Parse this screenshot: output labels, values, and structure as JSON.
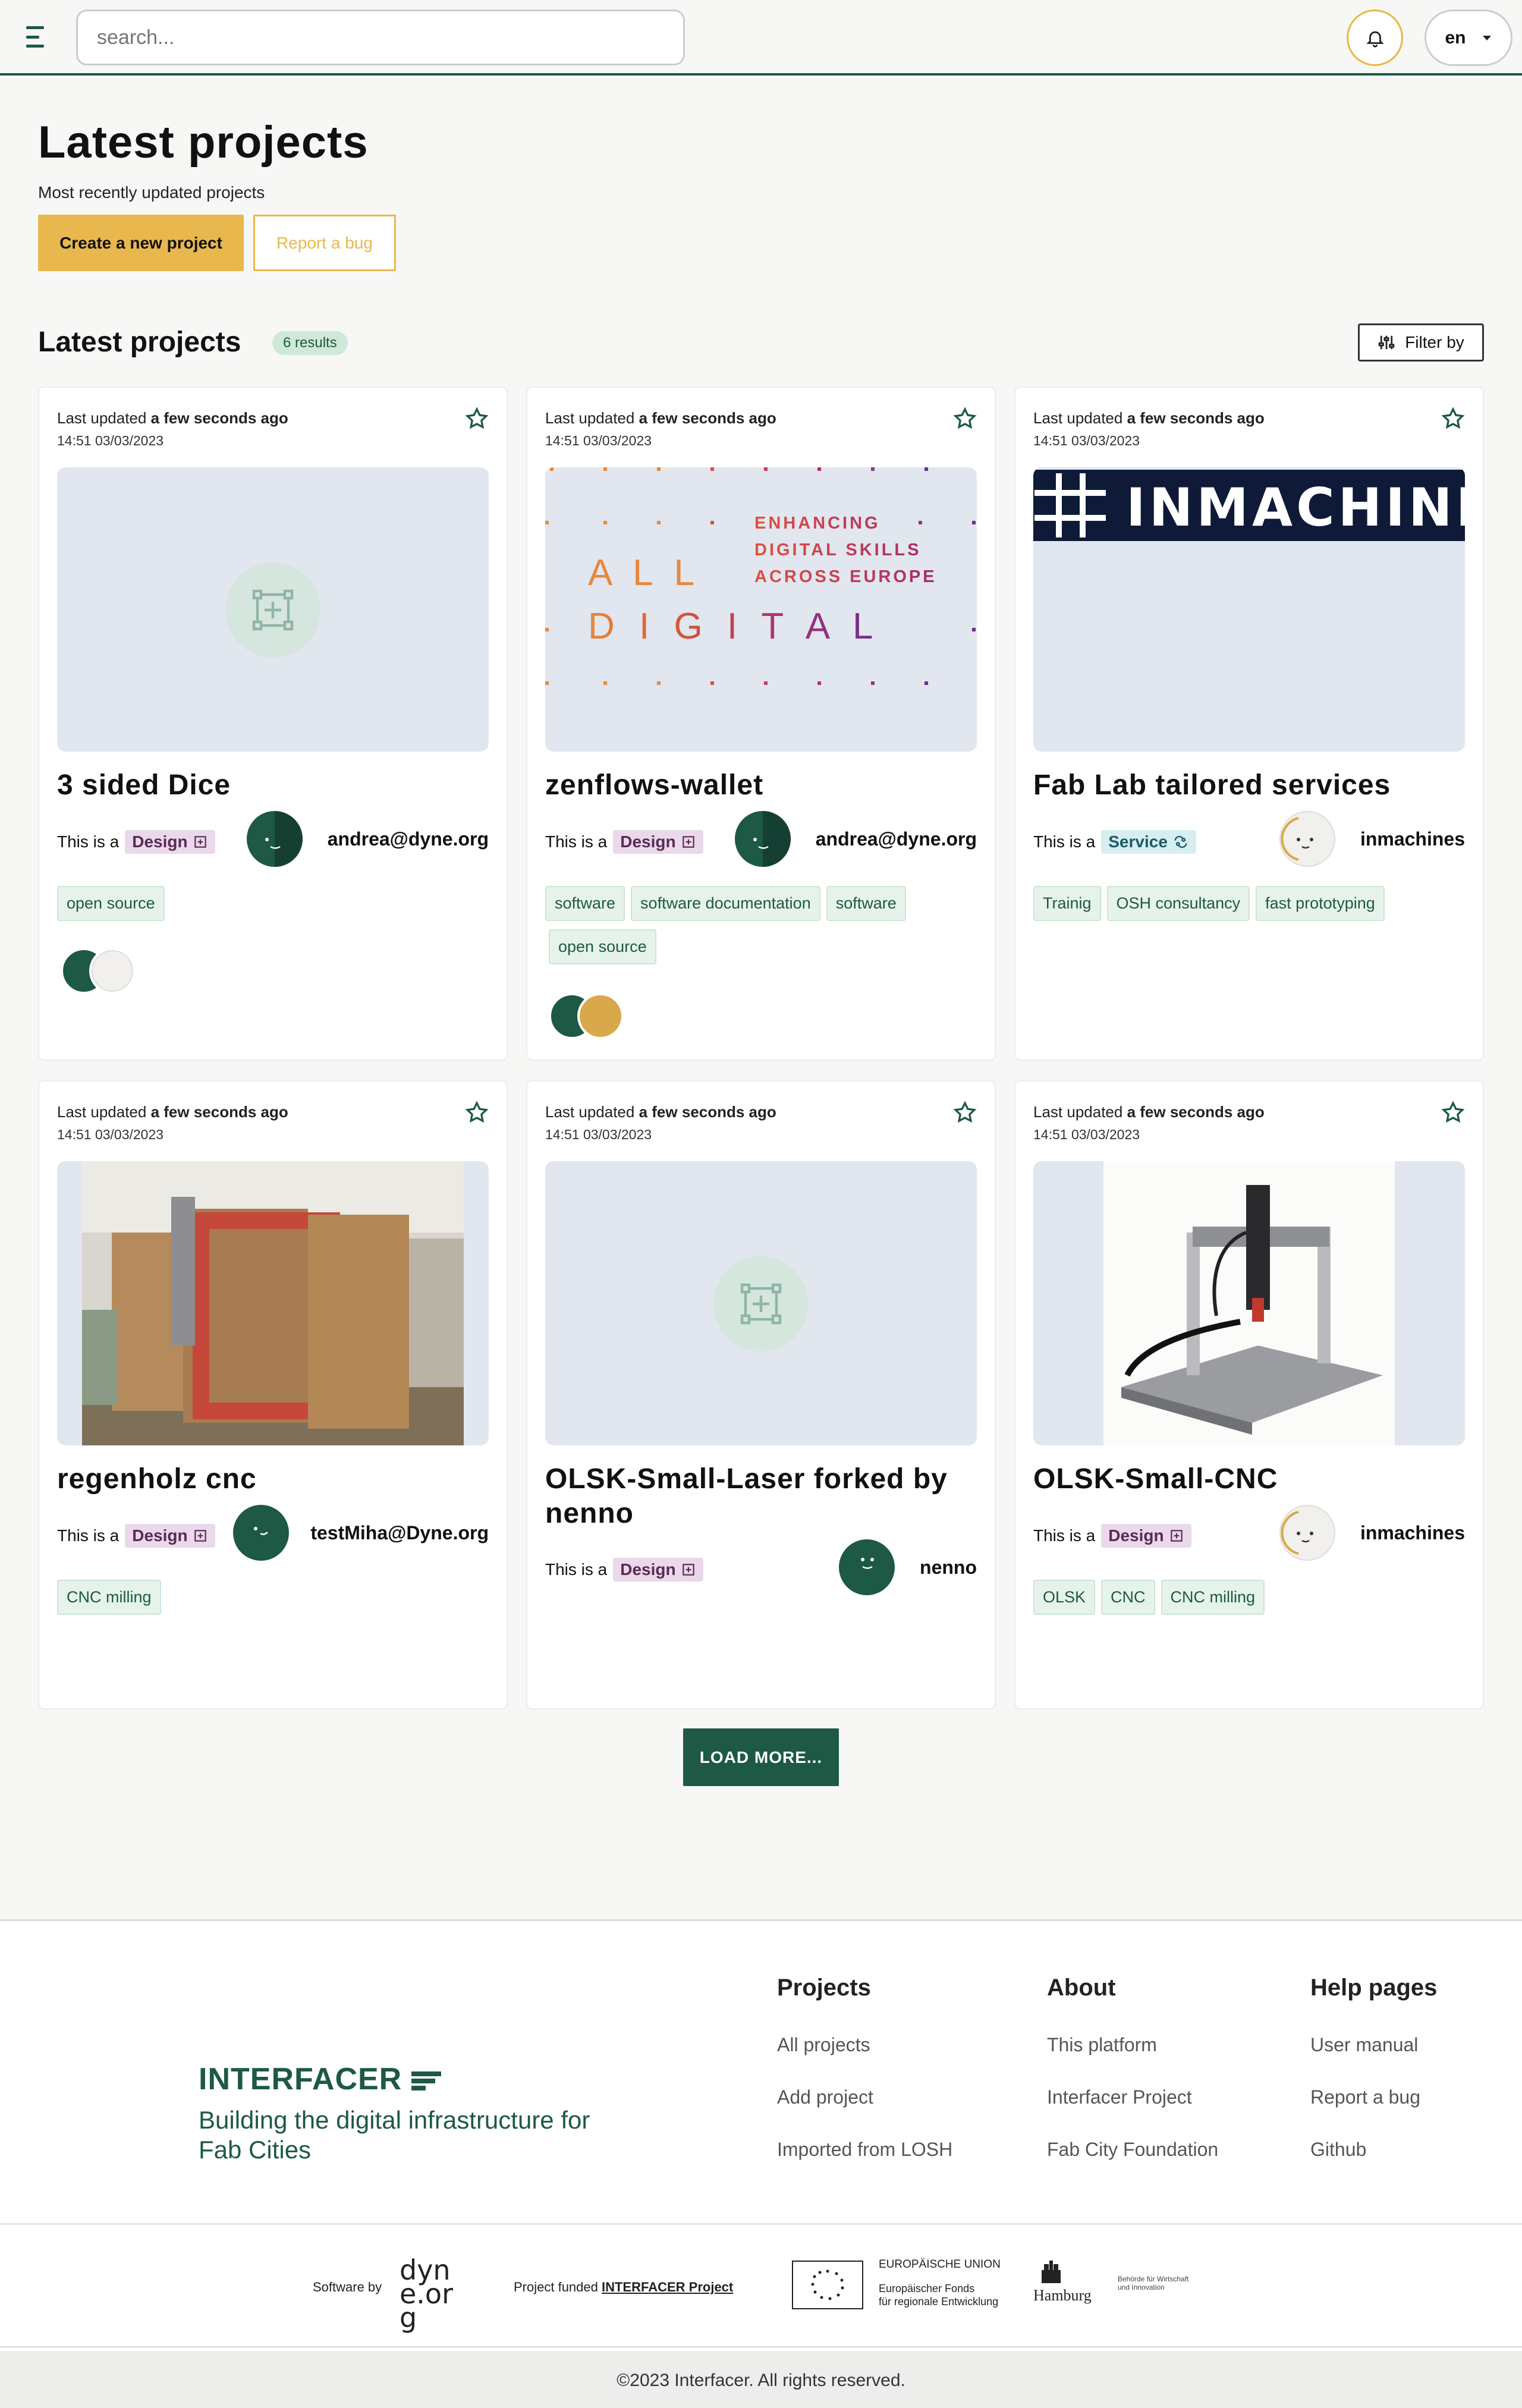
{
  "topbar": {
    "search_placeholder": "search...",
    "language": "en"
  },
  "header": {
    "title": "Latest projects",
    "subtitle": "Most recently updated projects",
    "create_label": "Create a new project",
    "bug_label": "Report a bug"
  },
  "list": {
    "title": "Latest projects",
    "results": "6 results",
    "filter_label": "Filter by"
  },
  "cards": [
    {
      "updated_prefix": "Last updated ",
      "updated_rel": "a few seconds ago",
      "date": "14:51 03/03/2023",
      "title": "3 sided Dice",
      "is_a": "This is a",
      "type": "Design",
      "owner": "andrea@dyne.org",
      "tags": [
        "open source"
      ]
    },
    {
      "updated_prefix": "Last updated ",
      "updated_rel": "a few seconds ago",
      "date": "14:51 03/03/2023",
      "title": "zenflows-wallet",
      "is_a": "This is a",
      "type": "Design",
      "owner": "andrea@dyne.org",
      "tags": [
        "software",
        "software documentation",
        "software",
        "open source"
      ],
      "image_text": {
        "line1": "ENHANCING",
        "line2": "DIGITAL SKILLS",
        "line3": "ACROSS EUROPE",
        "word1": "A L L",
        "word2": "D I G I T A L"
      }
    },
    {
      "updated_prefix": "Last updated ",
      "updated_rel": "a few seconds ago",
      "date": "14:51 03/03/2023",
      "title": "Fab Lab tailored services",
      "is_a": "This is a",
      "type": "Service",
      "owner": "inmachines",
      "tags": [
        "Trainig",
        "OSH consultancy",
        "fast prototyping"
      ],
      "image_text": {
        "logo": "INMACHINES"
      }
    },
    {
      "updated_prefix": "Last updated ",
      "updated_rel": "a few seconds ago",
      "date": "14:51 03/03/2023",
      "title": "regenholz cnc",
      "is_a": "This is a",
      "type": "Design",
      "owner": "testMiha@Dyne.org",
      "tags": [
        "CNC milling"
      ]
    },
    {
      "updated_prefix": "Last updated ",
      "updated_rel": "a few seconds ago",
      "date": "14:51 03/03/2023",
      "title": "OLSK-Small-Laser forked by nenno",
      "is_a": "This is a",
      "type": "Design",
      "owner": "nenno",
      "tags": []
    },
    {
      "updated_prefix": "Last updated ",
      "updated_rel": "a few seconds ago",
      "date": "14:51 03/03/2023",
      "title": "OLSK-Small-CNC",
      "is_a": "This is a",
      "type": "Design",
      "owner": "inmachines",
      "tags": [
        "OLSK",
        "CNC",
        "CNC milling"
      ]
    }
  ],
  "load_more": "LOAD MORE...",
  "footer": {
    "brand": "INTERFACER",
    "tagline": "Building the digital infrastructure for Fab Cities",
    "columns": [
      {
        "title": "Projects",
        "links": [
          "All projects",
          "Add project",
          "Imported from LOSH"
        ]
      },
      {
        "title": "About",
        "links": [
          "This platform",
          "Interfacer Project",
          "Fab City Foundation"
        ]
      },
      {
        "title": "Help pages",
        "links": [
          "User manual",
          "Report a bug",
          "Github"
        ]
      }
    ],
    "software_by": "Software by",
    "dyne_logo": "dyne.org",
    "funded_prefix": "Project funded ",
    "funded_link": "INTERFACER Project",
    "eu_line1": "EUROPÄISCHE UNION",
    "eu_line2": "Europäischer Fonds",
    "eu_line3": "für regionale Entwicklung",
    "hamburg": "Hamburg",
    "hamburg_sub1": "Behörde für Wirtschaft",
    "hamburg_sub2": "und Innovation",
    "copyright": "©2023 Interfacer. All rights reserved."
  },
  "colors": {
    "primary": "#1d5945",
    "accent": "#e8b84f",
    "design_badge": "#ead9ea",
    "service_badge": "#d6eef0",
    "tag_bg": "#e6f3ea"
  }
}
